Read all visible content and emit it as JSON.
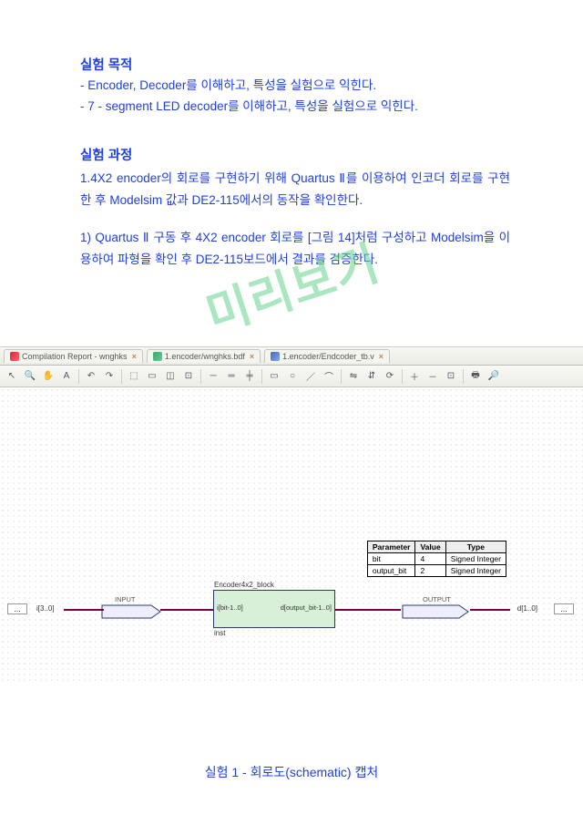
{
  "text": {
    "objective_heading": " 실험 목적",
    "obj_bullet1": "- Encoder, Decoder를 이해하고, 특성을 실험으로 익힌다.",
    "obj_bullet2": "- 7 - segment LED decoder를 이해하고, 특성을 실험으로 익힌다.",
    "process_heading": "실험 과정",
    "process_p1": "1.4X2 encoder의 회로를 구현하기 위해 Quartus Ⅱ를 이용하여 인코더 회로를 구현한 후 Modelsim 값과 DE2-115에서의 동작을 확인한다.",
    "process_p2": "1) Quartus Ⅱ 구동 후 4X2 encoder 회로를 [그림 14]처럼 구성하고 Modelsim을 이용하여 파형을 확인 후 DE2-115보드에서 결과를 검증한다.",
    "watermark": "미리보기",
    "figure_caption": "실험 1 - 회로도(schematic) 캡처"
  },
  "tabs": {
    "tab1": "Compilation Report - wnghks",
    "tab2": "1.encoder/wnghks.bdf",
    "tab3": "1.encoder/Endcoder_tb.v"
  },
  "toolbar_icons": [
    "⎘",
    "⌕",
    "✋",
    "A",
    "⟲",
    "⟳",
    "⊞",
    "⊟",
    "│",
    "↶",
    "↷",
    "│",
    "⬚",
    "⬚",
    "◫",
    "⊡",
    "│",
    "⟶",
    "⎍",
    "⎍",
    "⬚",
    "│",
    "⊡",
    "⊡",
    "│",
    "▱",
    "⊞",
    "⊟",
    "⬚",
    "│",
    "⊡",
    "⊡",
    "⊡"
  ],
  "param": {
    "h1": "Parameter",
    "h2": "Value",
    "h3": "Type",
    "r1c1": "bit",
    "r1c2": "4",
    "r1c3": "Signed Integer",
    "r2c1": "output_bit",
    "r2c2": "2",
    "r2c3": "Signed Integer"
  },
  "schematic": {
    "input_label": "i[3..0]",
    "input_caption": "INPUT",
    "block_title": "Encoder4x2_block",
    "block_in": "i[bit-1..0]",
    "block_out": "d[output_bit-1..0]",
    "block_inst": "inst",
    "output_caption": "OUTPUT",
    "output_label": "d[1..0]"
  }
}
